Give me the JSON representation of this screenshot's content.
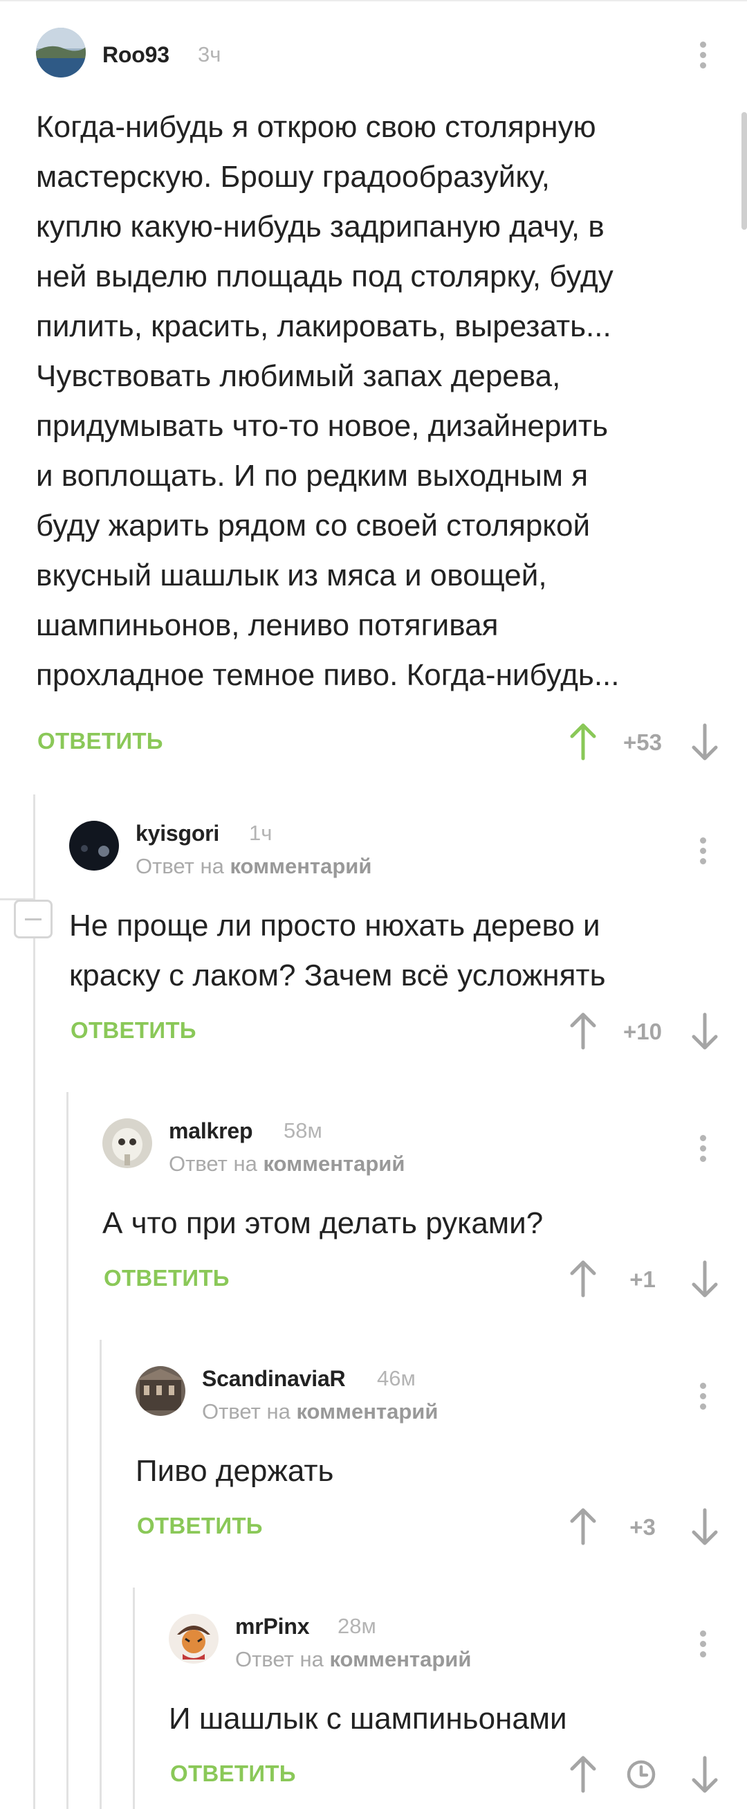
{
  "comments": [
    {
      "author": "Roo93",
      "time": "3ч",
      "lines": [
        "Когда-нибудь я открою свою столярную",
        "мастерскую. Брошу градообразуйку,",
        "куплю какую-нибудь задрипаную дачу, в",
        "ней выделю площадь под столярку, буду",
        "пилить, красить, лакировать, вырезать...",
        "Чувствовать любимый запах дерева,",
        "придумывать что-то новое, дизайнерить",
        "и воплощать. И по редким выходным я",
        "буду жарить рядом со своей столяркой",
        "вкусный шашлык из мяса и овощей,",
        "шампиньонов, лениво потягивая",
        "прохладное темное пиво. Когда-нибудь..."
      ],
      "reply_label": "ОТВЕТИТЬ",
      "score": "+53",
      "upvoted": true
    },
    {
      "author": "kyisgori",
      "time": "1ч",
      "reply_prefix": "Ответ на",
      "reply_target": "комментарий",
      "lines": [
        "Не проще ли просто нюхать дерево и",
        "краску с лаком? Зачем всё усложнять"
      ],
      "reply_label": "ОТВЕТИТЬ",
      "score": "+10"
    },
    {
      "author": "malkrep",
      "time": "58м",
      "reply_prefix": "Ответ на",
      "reply_target": "комментарий",
      "lines": [
        "А что при этом делать руками?"
      ],
      "reply_label": "ОТВЕТИТЬ",
      "score": "+1"
    },
    {
      "author": "ScandinaviaR",
      "time": "46м",
      "reply_prefix": "Ответ на",
      "reply_target": "комментарий",
      "lines": [
        "Пиво держать"
      ],
      "reply_label": "ОТВЕТИТЬ",
      "score": "+3"
    },
    {
      "author": "mrPinx",
      "time": "28м",
      "reply_prefix": "Ответ на",
      "reply_target": "комментарий",
      "lines": [
        "И шашлык с шампиньонами"
      ],
      "reply_label": "ОТВЕТИТЬ",
      "score_icon": "clock-icon"
    }
  ],
  "colors": {
    "accent_green": "#8ac858",
    "muted_gray": "#b4b4b4",
    "thread_line": "#e2e2e2"
  }
}
